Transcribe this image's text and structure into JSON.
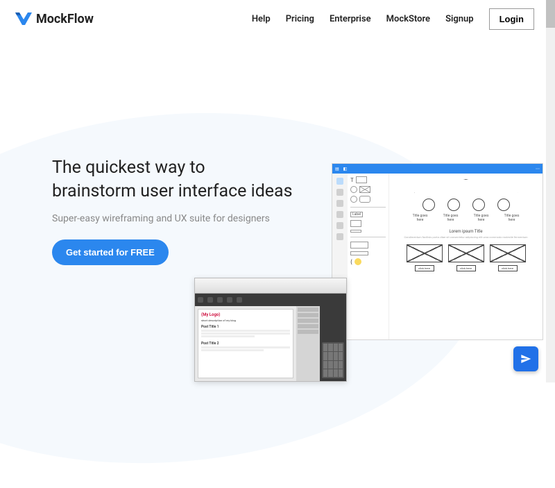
{
  "brand": {
    "name": "MockFlow"
  },
  "nav": {
    "help": "Help",
    "pricing": "Pricing",
    "enterprise": "Enterprise",
    "mockstore": "MockStore",
    "signup": "Signup",
    "login": "Login"
  },
  "hero": {
    "headline_l1": "The quickest way to",
    "headline_l2": "brainstorm user interface ideas",
    "subhead": "Super-easy wireframing and UX suite for designers",
    "cta": "Get started for FREE"
  },
  "wire_panel": {
    "caption": "Title goes here",
    "lipsum_title": "Lorem ipsum Title",
    "lipsum_text": "Condimentum facilisis porta vitae sit consectetur adipiscing elit urna commodo molestie fermentum",
    "card_btn": "click here",
    "palette": {
      "label_btn": "Label"
    }
  },
  "editor_panel": {
    "logo": "(My Logo)",
    "tagline": "short description of my blog",
    "post1": "Post Title 1",
    "post2": "Post Title 2"
  },
  "icons": {
    "send": "send-icon"
  }
}
